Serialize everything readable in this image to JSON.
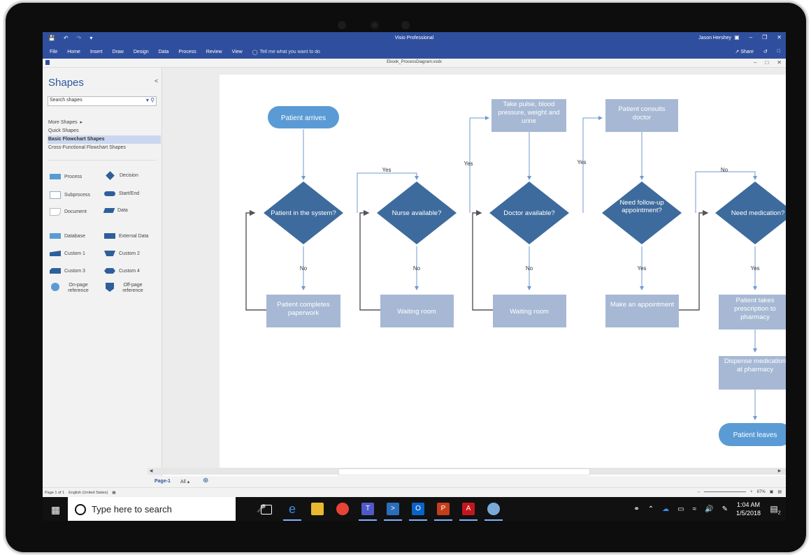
{
  "window": {
    "app_title": "Visio Professional",
    "user": "Jason Hershey",
    "share_label": "Share"
  },
  "ribbon": {
    "tabs": [
      "File",
      "Home",
      "Insert",
      "Draw",
      "Design",
      "Data",
      "Process",
      "Review",
      "View"
    ],
    "tell_me": "Tell me what you want to do"
  },
  "document": {
    "title": "Ebook_ProcessDiagram.vsdx"
  },
  "shapes_pane": {
    "title": "Shapes",
    "search_placeholder": "Search shapes",
    "menu": [
      "More Shapes",
      "Quick Shapes",
      "Basic Flowchart Shapes",
      "Cross-Functional Flowchart Shapes"
    ],
    "selected": "Basic Flowchart Shapes",
    "stencil": [
      {
        "label": "Process",
        "icon": "process-shape-icon"
      },
      {
        "label": "Decision",
        "icon": "decision-shape-icon"
      },
      {
        "label": "Subprocess",
        "icon": "subprocess-shape-icon"
      },
      {
        "label": "Start/End",
        "icon": "startend-shape-icon"
      },
      {
        "label": "Document",
        "icon": "document-shape-icon"
      },
      {
        "label": "Data",
        "icon": "data-shape-icon"
      },
      {
        "label": "Database",
        "icon": "database-shape-icon"
      },
      {
        "label": "External Data",
        "icon": "external-data-shape-icon"
      },
      {
        "label": "Custom 1",
        "icon": "custom1-shape-icon"
      },
      {
        "label": "Custom 2",
        "icon": "custom2-shape-icon"
      },
      {
        "label": "Custom 3",
        "icon": "custom3-shape-icon"
      },
      {
        "label": "Custom 4",
        "icon": "custom4-shape-icon"
      },
      {
        "label": "On-page reference",
        "icon": "onpage-reference-icon"
      },
      {
        "label": "Off-page reference",
        "icon": "offpage-reference-icon"
      }
    ]
  },
  "diagram": {
    "nodes": {
      "start": "Patient arrives",
      "d1": "Patient in the system?",
      "d2": "Nurse available?",
      "d3": "Doctor available?",
      "d4": "Need follow-up appointment?",
      "d5": "Need medication?",
      "p1": "Patient completes paperwork",
      "p2": "Waiting room",
      "p3": "Waiting room",
      "p4": "Make an appointment",
      "p5": "Patient takes prescription to pharmacy",
      "t1": "Take pulse, blood pressure, weight and urine",
      "t2": "Patient consults doctor",
      "p6": "Dispense medication at pharmacy",
      "end": "Patient leaves"
    },
    "edge_labels": {
      "yes": "Yes",
      "no": "No"
    },
    "colors": {
      "decision": "#3e6b9d",
      "process": "#a6b8d4",
      "terminator": "#5b9bd5",
      "connector": "#555555",
      "arrow_blue": "#6f9ad0"
    }
  },
  "page_tabs": {
    "current": "Page-1",
    "all": "All"
  },
  "status": {
    "page": "Page 1 of 1",
    "language": "English (United States)",
    "zoom": "87%"
  },
  "taskbar": {
    "search_placeholder": "Type here to search",
    "time": "1:04 AM",
    "date": "1/5/2018",
    "notifications": "2"
  }
}
